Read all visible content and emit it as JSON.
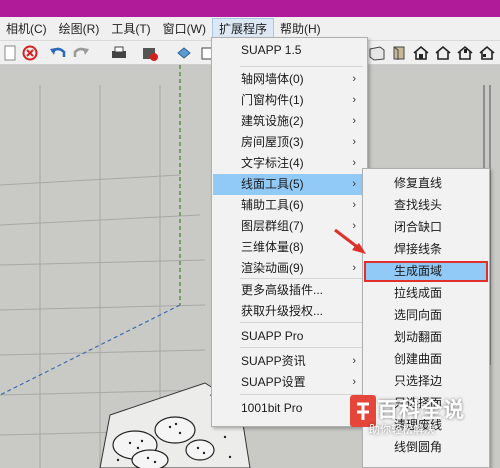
{
  "titlebar": {
    "color": "#b01b9a"
  },
  "menubar": {
    "items": [
      {
        "label": "相机(C)"
      },
      {
        "label": "绘图(R)"
      },
      {
        "label": "工具(T)"
      },
      {
        "label": "窗口(W)"
      },
      {
        "label": "扩展程序"
      },
      {
        "label": "帮助(H)"
      }
    ]
  },
  "toolbar": {
    "left_icons": [
      "page-icon",
      "erase-icon",
      "undo-icon",
      "redo-icon",
      "print-icon",
      "model-info-icon",
      "component-icon",
      "box-icon"
    ],
    "right_icons": [
      "front-view-icon",
      "iso-view-icon",
      "house-view-icon",
      "house-outline-icon",
      "house-back-icon",
      "house-side-icon"
    ]
  },
  "main_menu": {
    "items": [
      {
        "label": "SUAPP 1.5",
        "submenu": false
      },
      {
        "label": "轴网墙体(0)",
        "submenu": true
      },
      {
        "label": "门窗构件(1)",
        "submenu": true
      },
      {
        "label": "建筑设施(2)",
        "submenu": true
      },
      {
        "label": "房间屋顶(3)",
        "submenu": true
      },
      {
        "label": "文字标注(4)",
        "submenu": true
      },
      {
        "label": "线面工具(5)",
        "submenu": true
      },
      {
        "label": "辅助工具(6)",
        "submenu": true
      },
      {
        "label": "图层群组(7)",
        "submenu": true
      },
      {
        "label": "三维体量(8)",
        "submenu": true
      },
      {
        "label": "渲染动画(9)",
        "submenu": true
      },
      {
        "label": "更多高级插件...",
        "submenu": false
      },
      {
        "label": "获取升级授权...",
        "submenu": false
      },
      {
        "label": "SUAPP Pro",
        "submenu": false
      },
      {
        "label": "SUAPP资讯",
        "submenu": true
      },
      {
        "label": "SUAPP设置",
        "submenu": true
      },
      {
        "label": "1001bit Pro",
        "submenu": false
      }
    ],
    "selected": "线面工具(5)"
  },
  "sub_menu": {
    "items": [
      {
        "label": "修复直线"
      },
      {
        "label": "查找线头"
      },
      {
        "label": "闭合缺口"
      },
      {
        "label": "焊接线条"
      },
      {
        "label": "生成面域"
      },
      {
        "label": "拉线成面"
      },
      {
        "label": "选同向面"
      },
      {
        "label": "划动翻面"
      },
      {
        "label": "创建曲面"
      },
      {
        "label": "只选择边"
      },
      {
        "label": "只选择面"
      },
      {
        "label": "清理废线"
      },
      {
        "label": "线倒圆角"
      }
    ],
    "highlighted": "生成面域"
  },
  "watermark": {
    "title": "百科全说",
    "subtitle": "助你轻松解决"
  },
  "colors": {
    "menu_highlight": "#91c9f7",
    "callout_red": "#e0302a",
    "viewport_bg": "#c9c9c6"
  }
}
